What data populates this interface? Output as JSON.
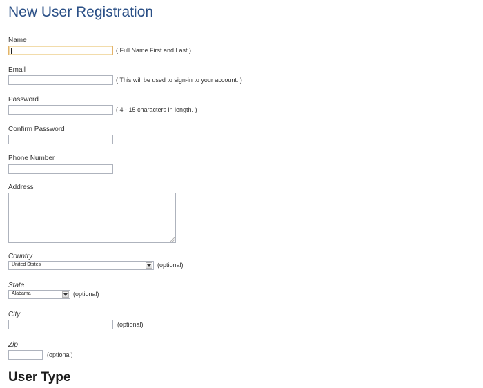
{
  "page": {
    "title": "New User Registration",
    "section_title": "User Type"
  },
  "form": {
    "name": {
      "label": "Name",
      "value": "",
      "hint": "( Full Name First and Last )"
    },
    "email": {
      "label": "Email",
      "value": "",
      "hint": "( This will be used to sign-in to your account. )"
    },
    "password": {
      "label": "Password",
      "value": "",
      "hint": "( 4 - 15 characters in length. )"
    },
    "confirm_password": {
      "label": "Confirm Password",
      "value": ""
    },
    "phone": {
      "label": "Phone Number",
      "value": ""
    },
    "address": {
      "label": "Address",
      "value": ""
    },
    "country": {
      "label": "Country",
      "selected": "United States",
      "hint": "(optional)"
    },
    "state": {
      "label": "State",
      "selected": "Alabama",
      "hint": "(optional)"
    },
    "city": {
      "label": "City",
      "value": "",
      "hint": "(optional)"
    },
    "zip": {
      "label": "Zip",
      "value": "",
      "hint": "(optional)"
    }
  }
}
